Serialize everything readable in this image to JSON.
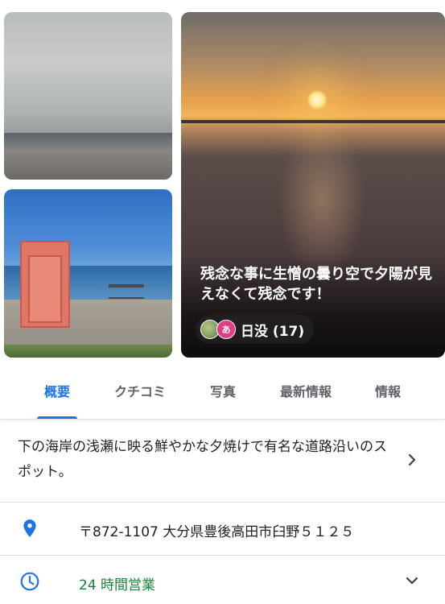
{
  "hero": {
    "caption": "残念な事に生憎の曇り空で夕陽が見えなくて残念です！",
    "chip_label": "日没 (17)",
    "avatar_letter": "あ"
  },
  "tabs": [
    {
      "label": "概要",
      "active": true
    },
    {
      "label": "クチコミ",
      "active": false
    },
    {
      "label": "写真",
      "active": false
    },
    {
      "label": "最新情報",
      "active": false
    },
    {
      "label": "情報",
      "active": false
    }
  ],
  "overview": {
    "description": "下の海岸の浅瀬に映る鮮やかな夕焼けで有名な道路沿いのスポット。",
    "address": "〒872-1107 大分県豊後高田市臼野５１２５",
    "hours": "24 時間営業"
  },
  "colors": {
    "accent": "#1a73e8",
    "open_green": "#188038"
  },
  "icons": {
    "address": "location-pin-icon",
    "hours": "clock-icon",
    "expand": "chevron-down-icon",
    "more": "chevron-right-icon"
  }
}
